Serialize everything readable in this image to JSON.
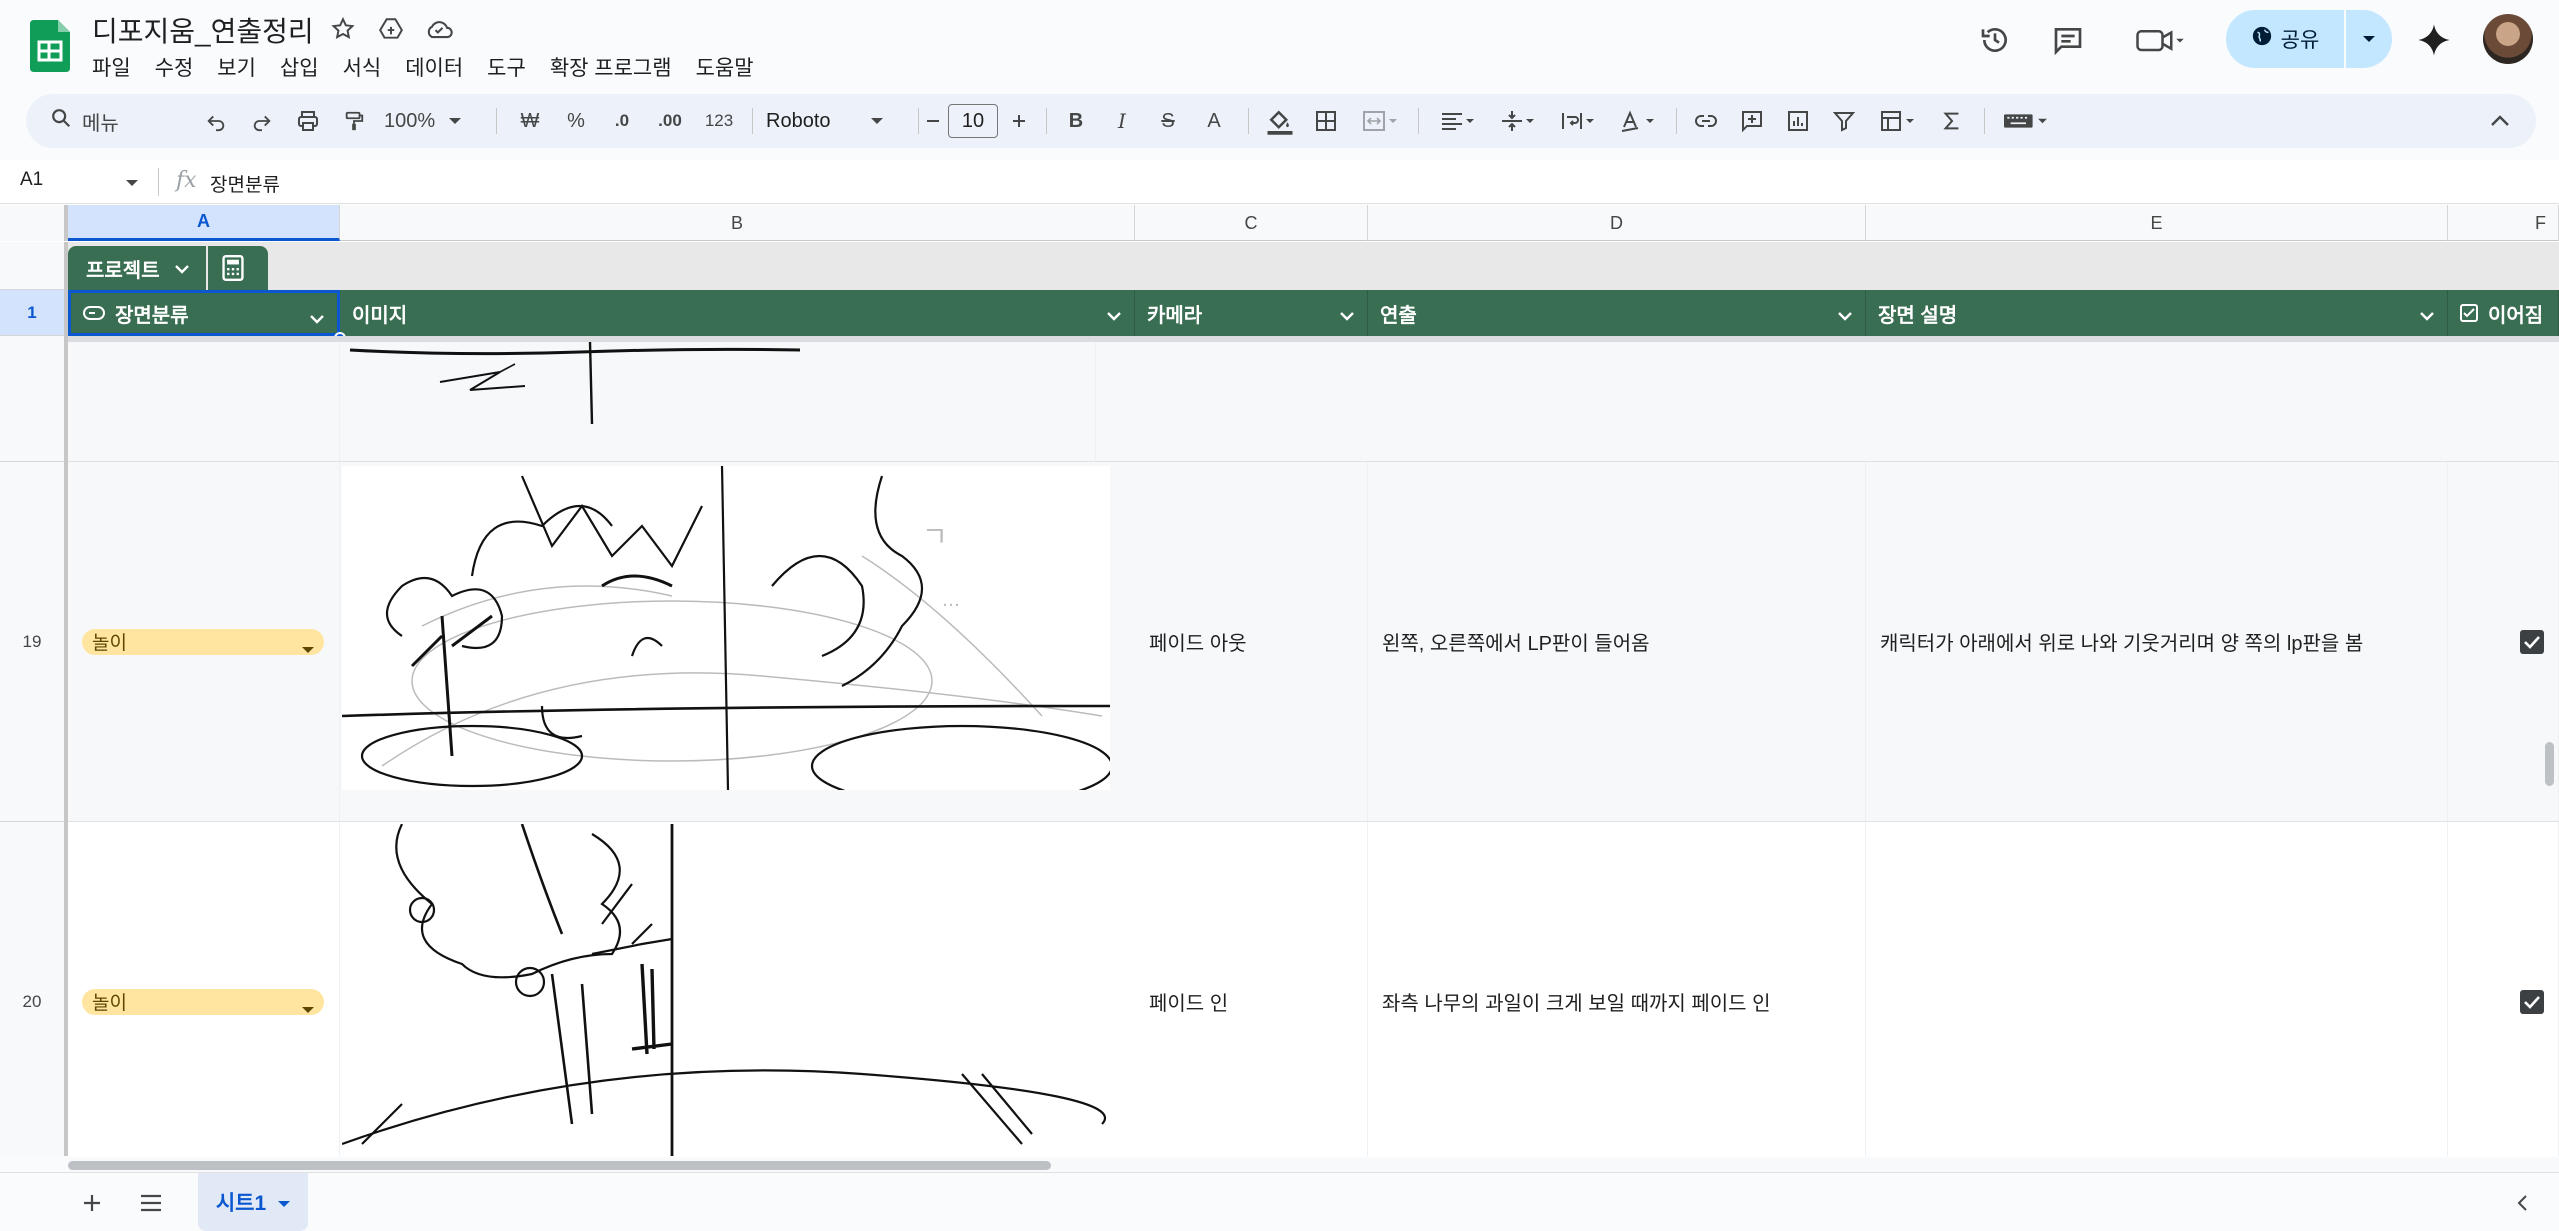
{
  "app": {
    "doc_title": "디포지움_연출정리",
    "menu": [
      "파일",
      "수정",
      "보기",
      "삽입",
      "서식",
      "데이터",
      "도구",
      "확장 프로그램",
      "도움말"
    ],
    "share_label": "공유",
    "colors": {
      "accent": "#0b57d0",
      "table_header": "#3a6e53",
      "chip": "#ffe5a0",
      "share_bg": "#c2e7ff"
    }
  },
  "toolbar": {
    "search_label": "메뉴",
    "zoom": "100%",
    "currency": "₩",
    "percent": "%",
    "dec_decrease": ".0",
    "dec_increase": ".00",
    "number_format": "123",
    "font_name": "Roboto",
    "font_size": "10",
    "bold": "B",
    "italic": "I",
    "strike": "S",
    "text_color": "A"
  },
  "formula_bar": {
    "cell_ref": "A1",
    "fx": "fx",
    "content": "장면분류"
  },
  "columns": [
    "A",
    "B",
    "C",
    "D",
    "E",
    "F"
  ],
  "table": {
    "name": "프로젝트",
    "headers": {
      "a": "장면분류",
      "b": "이미지",
      "c": "카메라",
      "d": "연출",
      "e": "장면 설명",
      "f": "이어짐"
    }
  },
  "row_numbers": {
    "header": "1",
    "r19": "19",
    "r20": "20"
  },
  "rows": [
    {
      "category": "놀이",
      "camera": "페이드 아웃",
      "direction": "왼쪽, 오른쪽에서 LP판이 들어옴",
      "description": "캐릭터가 아래에서 위로 나와 기웃거리며 양 쪽의 lp판을 봄",
      "checked": true
    },
    {
      "category": "놀이",
      "camera": "페이드 인",
      "direction": "좌측 나무의 과일이 크게 보일 때까지 페이드 인",
      "description": "",
      "checked": true
    }
  ],
  "sheet_tab": "시트1",
  "icons": [
    "sheets-logo-icon",
    "star-icon",
    "drive-move-icon",
    "cloud-status-icon",
    "history-icon",
    "comment-icon",
    "meet-icon",
    "globe-icon",
    "gemini-icon",
    "search-icon",
    "undo-icon",
    "redo-icon",
    "print-icon",
    "paint-format-icon"
  ]
}
